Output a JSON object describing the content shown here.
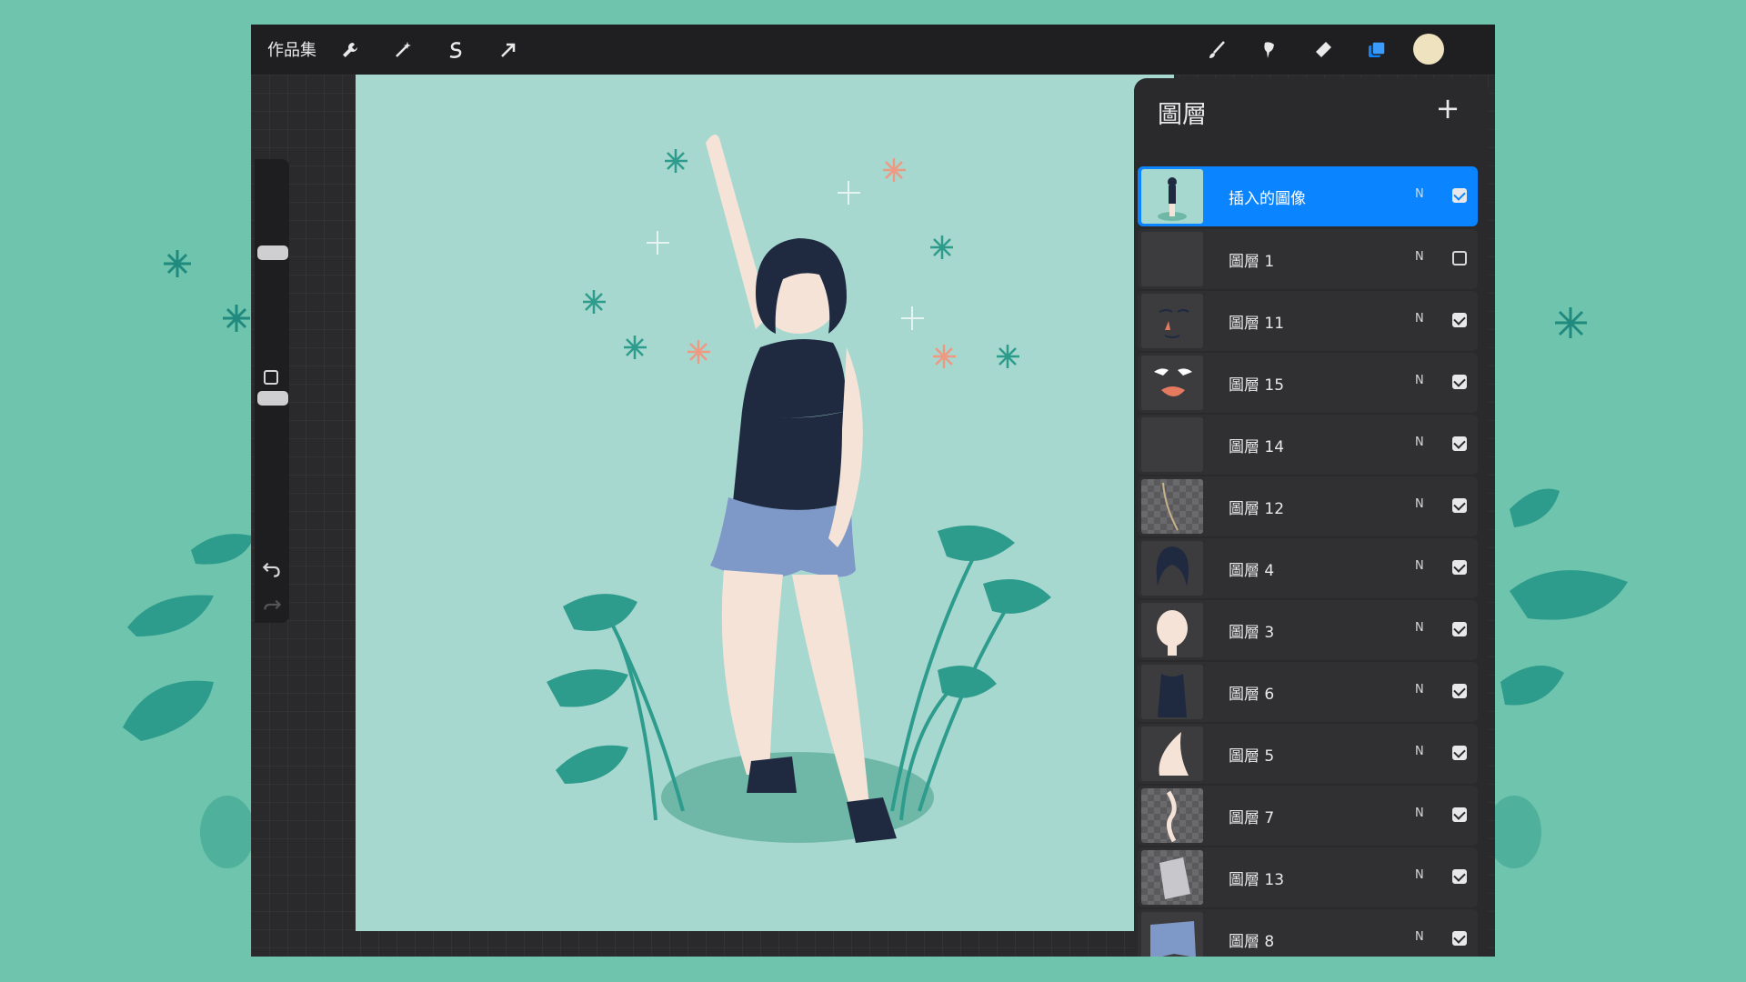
{
  "toolbar": {
    "gallery_label": "作品集",
    "left_icons": [
      "wrench-icon",
      "magic-wand-icon",
      "selection-icon",
      "transform-arrow-icon"
    ],
    "right_icons": [
      "brush-icon",
      "smudge-icon",
      "eraser-icon",
      "layers-icon",
      "color-swatch"
    ],
    "current_color": "#efe3bf",
    "layers_icon_color": "#0a84ff"
  },
  "sidebar": {
    "icons": [
      "brush-size-slider",
      "modify-square-button",
      "opacity-slider",
      "undo-icon",
      "redo-icon"
    ]
  },
  "layers_panel": {
    "title": "圖層",
    "add_icon": "+",
    "layers": [
      {
        "name": "插入的圖像",
        "mode": "N",
        "visible": true,
        "active": true
      },
      {
        "name": "圖層 1",
        "mode": "N",
        "visible": false,
        "active": false
      },
      {
        "name": "圖層 11",
        "mode": "N",
        "visible": true,
        "active": false
      },
      {
        "name": "圖層 15",
        "mode": "N",
        "visible": true,
        "active": false
      },
      {
        "name": "圖層 14",
        "mode": "N",
        "visible": true,
        "active": false
      },
      {
        "name": "圖層 12",
        "mode": "N",
        "visible": true,
        "active": false
      },
      {
        "name": "圖層 4",
        "mode": "N",
        "visible": true,
        "active": false
      },
      {
        "name": "圖層 3",
        "mode": "N",
        "visible": true,
        "active": false
      },
      {
        "name": "圖層 6",
        "mode": "N",
        "visible": true,
        "active": false
      },
      {
        "name": "圖層 5",
        "mode": "N",
        "visible": true,
        "active": false
      },
      {
        "name": "圖層 7",
        "mode": "N",
        "visible": true,
        "active": false
      },
      {
        "name": "圖層 13",
        "mode": "N",
        "visible": true,
        "active": false
      },
      {
        "name": "圖層 8",
        "mode": "N",
        "visible": true,
        "active": false
      }
    ]
  },
  "colors": {
    "background": "#6ec4ad",
    "canvas": "#a7d8d0",
    "leaf": "#2e9c8c",
    "accent": "#0a84ff"
  }
}
